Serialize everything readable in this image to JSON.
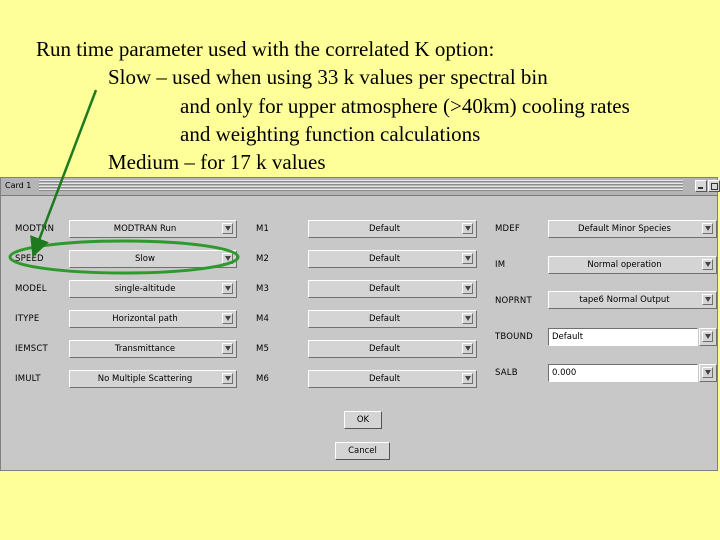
{
  "caption": {
    "lines": [
      "Run time parameter used with the correlated K option:",
      "Slow – used when using 33 k values per spectral bin",
      "and only for upper atmosphere (>40km) cooling rates",
      "and weighting function calculations",
      "Medium – for 17 k values"
    ]
  },
  "window": {
    "title": "Card 1"
  },
  "left": [
    {
      "label": "MODTRN",
      "value": "MODTRAN Run"
    },
    {
      "label": "SPEED",
      "value": "Slow"
    },
    {
      "label": "MODEL",
      "value": "single-altitude"
    },
    {
      "label": "ITYPE",
      "value": "Horizontal path"
    },
    {
      "label": "IEMSCT",
      "value": "Transmittance"
    },
    {
      "label": "IMULT",
      "value": "No Multiple Scattering"
    }
  ],
  "middle": [
    {
      "label": "M1",
      "value": "Default"
    },
    {
      "label": "M2",
      "value": "Default"
    },
    {
      "label": "M3",
      "value": "Default"
    },
    {
      "label": "M4",
      "value": "Default"
    },
    {
      "label": "M5",
      "value": "Default"
    },
    {
      "label": "M6",
      "value": "Default"
    }
  ],
  "right": {
    "mdef": {
      "label": "MDEF",
      "value": "Default Minor Species"
    },
    "im": {
      "label": "IM",
      "value": "Normal operation"
    },
    "noprnt": {
      "label": "NOPRNT",
      "value": "tape6 Normal Output"
    },
    "tbound": {
      "label": "TBOUND",
      "value": "Default"
    },
    "salb": {
      "label": "SALB",
      "value": "0.000"
    }
  },
  "buttons": {
    "ok": "OK",
    "cancel": "Cancel"
  },
  "colors": {
    "highlight_ellipse": "#2e9a2e",
    "arrow": "#1f7a1f",
    "background": "#ffff99"
  }
}
